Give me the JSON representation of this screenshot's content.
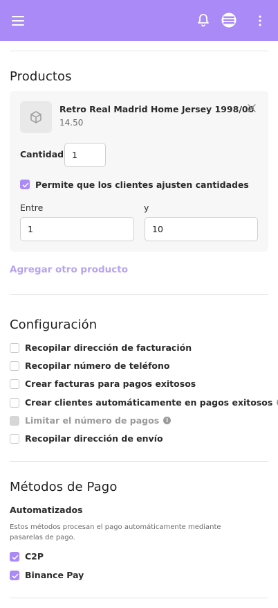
{
  "topbar": {
    "menu_icon": "hamburger-menu-icon",
    "bell_icon": "bell-icon",
    "avatar_icon": "stack-logo-icon",
    "more_icon": "vertical-dots-icon",
    "bg_color": "#a98af7"
  },
  "products": {
    "title": "Productos",
    "item": {
      "name": "Retro Real Madrid Home Jersey 1998/00",
      "price": "14.50",
      "thumb_icon": "box-icon",
      "remove_icon": "close-icon"
    },
    "quantity_label": "Cantidad",
    "quantity_value": "1",
    "adjust_label": "Permite que los clientes ajusten cantidades",
    "adjust_checked": true,
    "between_label": "Entre",
    "and_label": "y",
    "min_value": "1",
    "max_value": "10",
    "add_link": "Agregar otro producto"
  },
  "config": {
    "title": "Configuración",
    "options": [
      {
        "label": "Recopilar dirección de facturación",
        "checked": false,
        "disabled": false,
        "info": false
      },
      {
        "label": "Recopilar número de teléfono",
        "checked": false,
        "disabled": false,
        "info": false
      },
      {
        "label": "Crear facturas para pagos exitosos",
        "checked": false,
        "disabled": false,
        "info": false
      },
      {
        "label": "Crear clientes automáticamente en pagos exitosos",
        "checked": false,
        "disabled": false,
        "info": true
      },
      {
        "label": "Limitar el número de pagos",
        "checked": false,
        "disabled": true,
        "info": true
      },
      {
        "label": "Recopilar dirección de envío",
        "checked": false,
        "disabled": false,
        "info": false
      }
    ]
  },
  "payments": {
    "title": "Métodos de Pago",
    "auto_title": "Automatizados",
    "auto_desc": "Estos métodos procesan el pago automáticamente mediante pasarelas de pago.",
    "methods": [
      {
        "label": "C2P",
        "checked": true
      },
      {
        "label": "Binance Pay",
        "checked": true
      }
    ],
    "accent": "#a98af7"
  }
}
